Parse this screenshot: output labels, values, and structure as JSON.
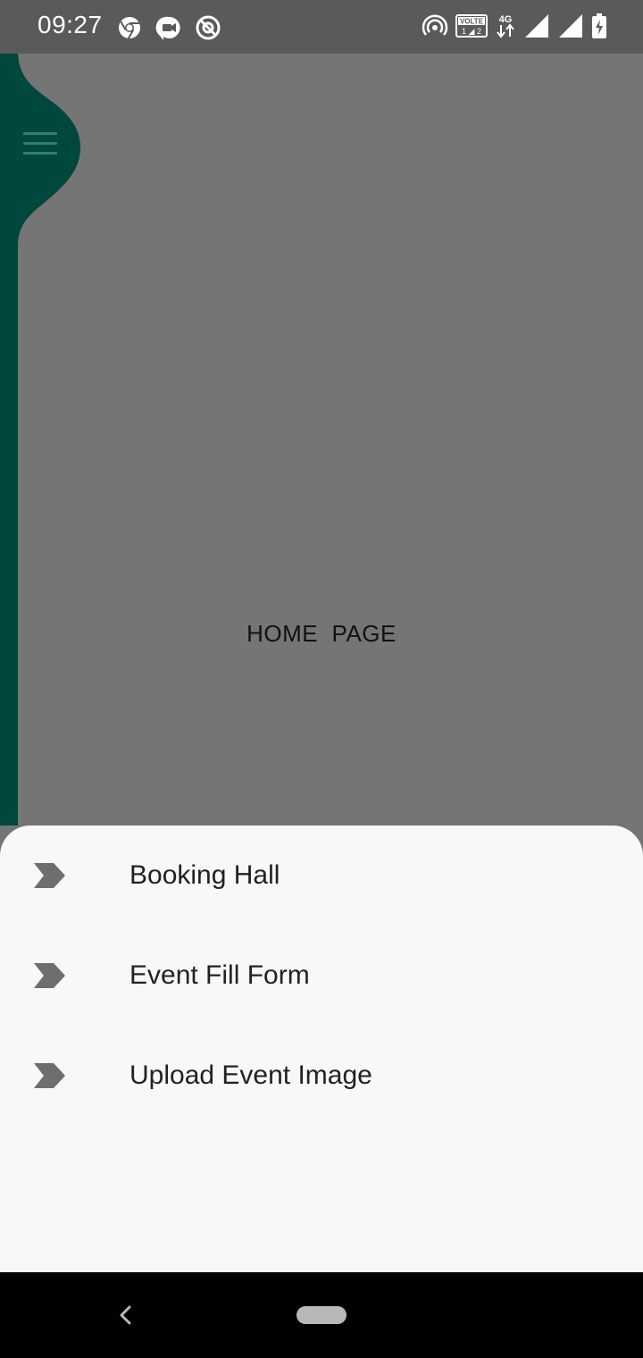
{
  "status_bar": {
    "time": "09:27",
    "left_icons": [
      "chrome-icon",
      "meet-icon",
      "blocked-icon"
    ],
    "right_icons": [
      "hotspot-icon",
      "volte-icon",
      "4g-icon",
      "signal-icon",
      "signal-icon",
      "battery-charging-icon"
    ],
    "volte_label": "VOLTE",
    "network_label": "4G"
  },
  "main": {
    "title": "HOME  PAGE",
    "menu_icon": "hamburger-menu-icon",
    "drawer_color": "#00473d"
  },
  "bottom_sheet": {
    "items": [
      {
        "label": "Booking Hall",
        "icon": "chevron-arrow-icon"
      },
      {
        "label": "Event Fill Form",
        "icon": "chevron-arrow-icon"
      },
      {
        "label": "Upload Event Image",
        "icon": "chevron-arrow-icon"
      }
    ]
  },
  "nav_bar": {
    "back_icon": "back-icon",
    "home_icon": "home-pill-icon"
  },
  "colors": {
    "scrim": "#757575",
    "sheet_background": "#f8f8f8",
    "drawer": "#00473d",
    "status_bar": "#5a5a5a"
  }
}
